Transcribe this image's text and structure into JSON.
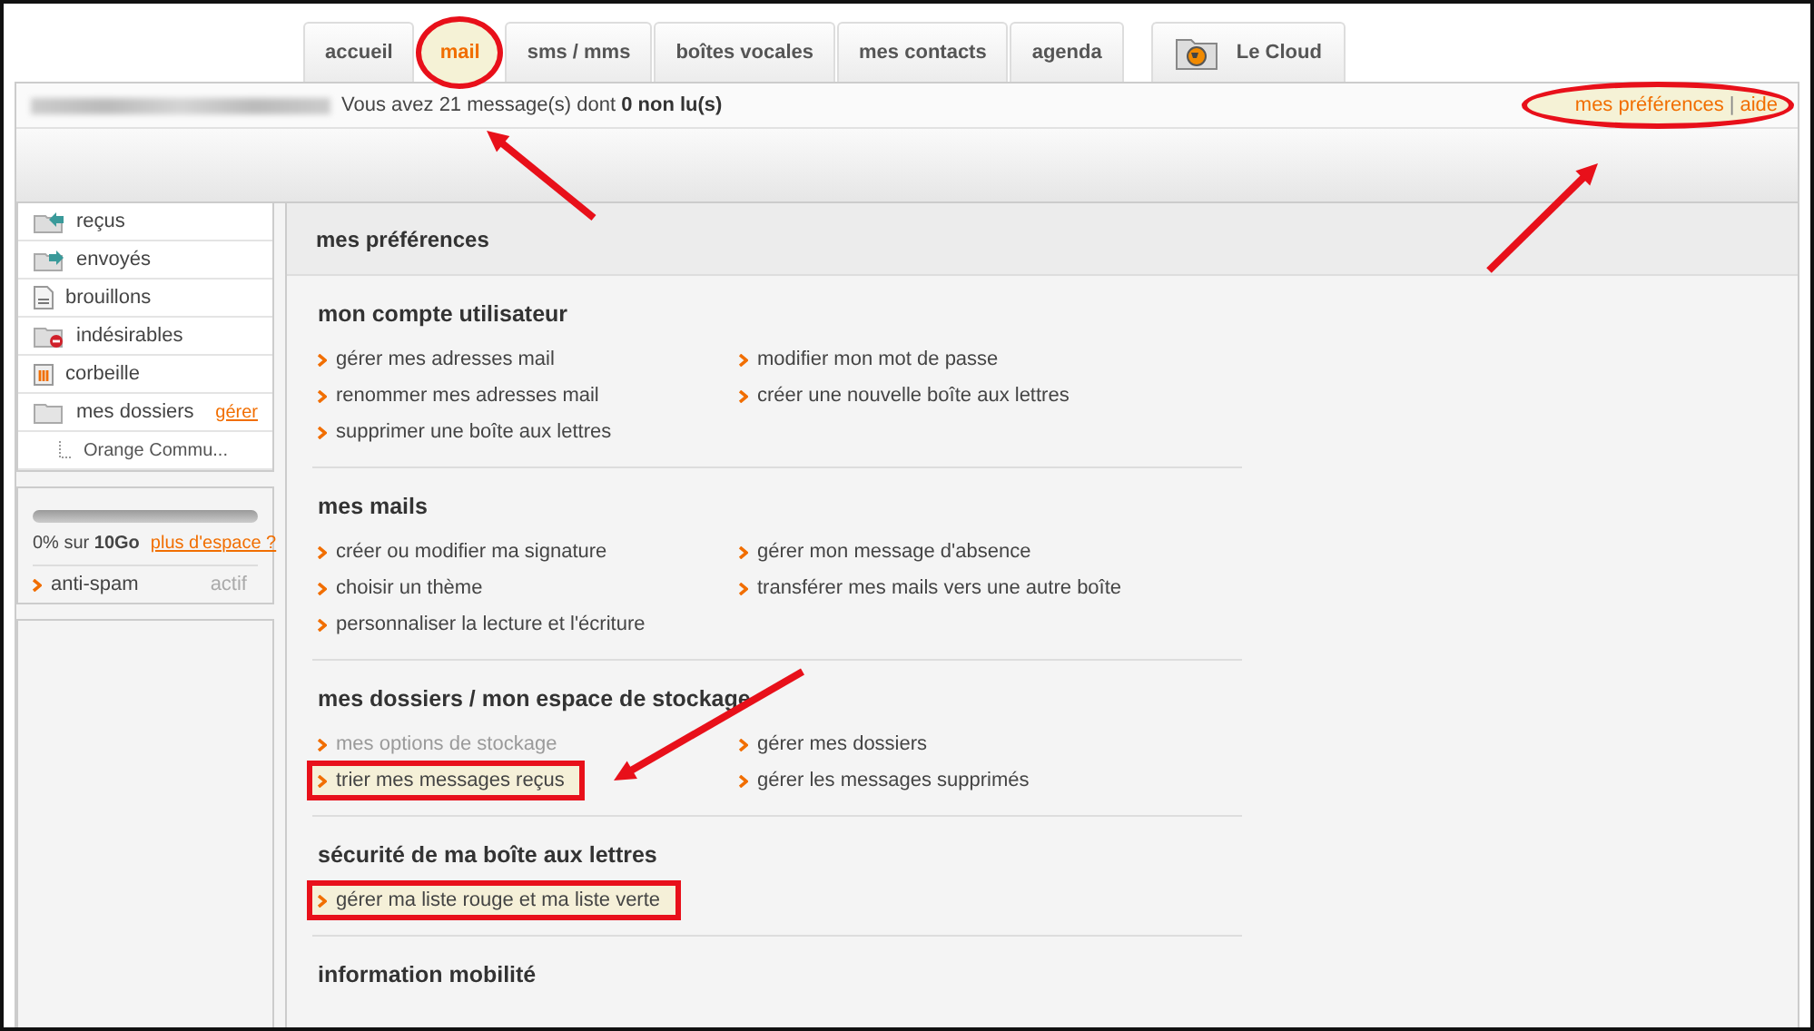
{
  "tabs": [
    {
      "label": "accueil",
      "selected": false,
      "circled": false
    },
    {
      "label": "mail",
      "selected": true,
      "circled": true
    },
    {
      "label": "sms / mms",
      "selected": false,
      "circled": false
    },
    {
      "label": "boîtes vocales",
      "selected": false,
      "circled": false
    },
    {
      "label": "mes contacts",
      "selected": false,
      "circled": false
    },
    {
      "label": "agenda",
      "selected": false,
      "circled": false
    }
  ],
  "cloud_tab": {
    "label": "Le Cloud"
  },
  "header": {
    "message": "Vous avez 21 message(s) dont **0 non lu(s)**",
    "links": [
      {
        "label": "mes préférences"
      },
      {
        "label": "aide"
      }
    ],
    "separator": "|",
    "links_circled": true
  },
  "sidebar": {
    "folders": [
      {
        "label": "reçus",
        "kind": "inbox"
      },
      {
        "label": "envoyés",
        "kind": "sent"
      },
      {
        "label": "brouillons",
        "kind": "drafts"
      },
      {
        "label": "indésirables",
        "kind": "spam"
      },
      {
        "label": "corbeille",
        "kind": "trash"
      },
      {
        "label": "mes dossiers",
        "kind": "folder",
        "action": "gérer",
        "children": [
          {
            "label": "Orange Commu..."
          }
        ]
      }
    ],
    "storage": {
      "level": 0,
      "usage": "0% sur **10Go**",
      "link": "plus d'espace ?"
    },
    "antispam": {
      "label": "anti-spam",
      "status": "actif"
    }
  },
  "main": {
    "title": "mes préférences",
    "sections": [
      {
        "heading": "mon compte utilisateur",
        "links": [
          {
            "label": "gérer mes adresses mail",
            "disabled": false,
            "highlighted": false
          },
          {
            "label": "modifier mon mot de passe",
            "disabled": false,
            "highlighted": false
          },
          {
            "label": "renommer mes adresses mail",
            "disabled": false,
            "highlighted": false
          },
          {
            "label": "créer une nouvelle boîte aux lettres",
            "disabled": false,
            "highlighted": false
          },
          {
            "label": "supprimer une boîte aux lettres",
            "disabled": false,
            "highlighted": false
          }
        ]
      },
      {
        "heading": "mes mails",
        "links": [
          {
            "label": "créer ou modifier ma signature",
            "disabled": false,
            "highlighted": false
          },
          {
            "label": "gérer mon message d'absence",
            "disabled": false,
            "highlighted": false
          },
          {
            "label": "choisir un thème",
            "disabled": false,
            "highlighted": false
          },
          {
            "label": "transférer mes mails vers une autre boîte",
            "disabled": false,
            "highlighted": false
          },
          {
            "label": "personnaliser la lecture et l'écriture",
            "disabled": false,
            "highlighted": false
          }
        ]
      },
      {
        "heading": "mes dossiers / mon espace de stockage",
        "links": [
          {
            "label": "mes options de stockage",
            "disabled": true,
            "highlighted": false
          },
          {
            "label": "gérer mes dossiers",
            "disabled": false,
            "highlighted": false
          },
          {
            "label": "trier mes messages reçus",
            "disabled": false,
            "highlighted": true
          },
          {
            "label": "gérer les messages supprimés",
            "disabled": false,
            "highlighted": false
          }
        ]
      },
      {
        "heading": "sécurité de ma boîte aux lettres",
        "links": [
          {
            "label": "gérer ma liste rouge et ma liste verte",
            "disabled": false,
            "highlighted": true
          }
        ]
      },
      {
        "heading": "information mobilité"
      }
    ]
  }
}
